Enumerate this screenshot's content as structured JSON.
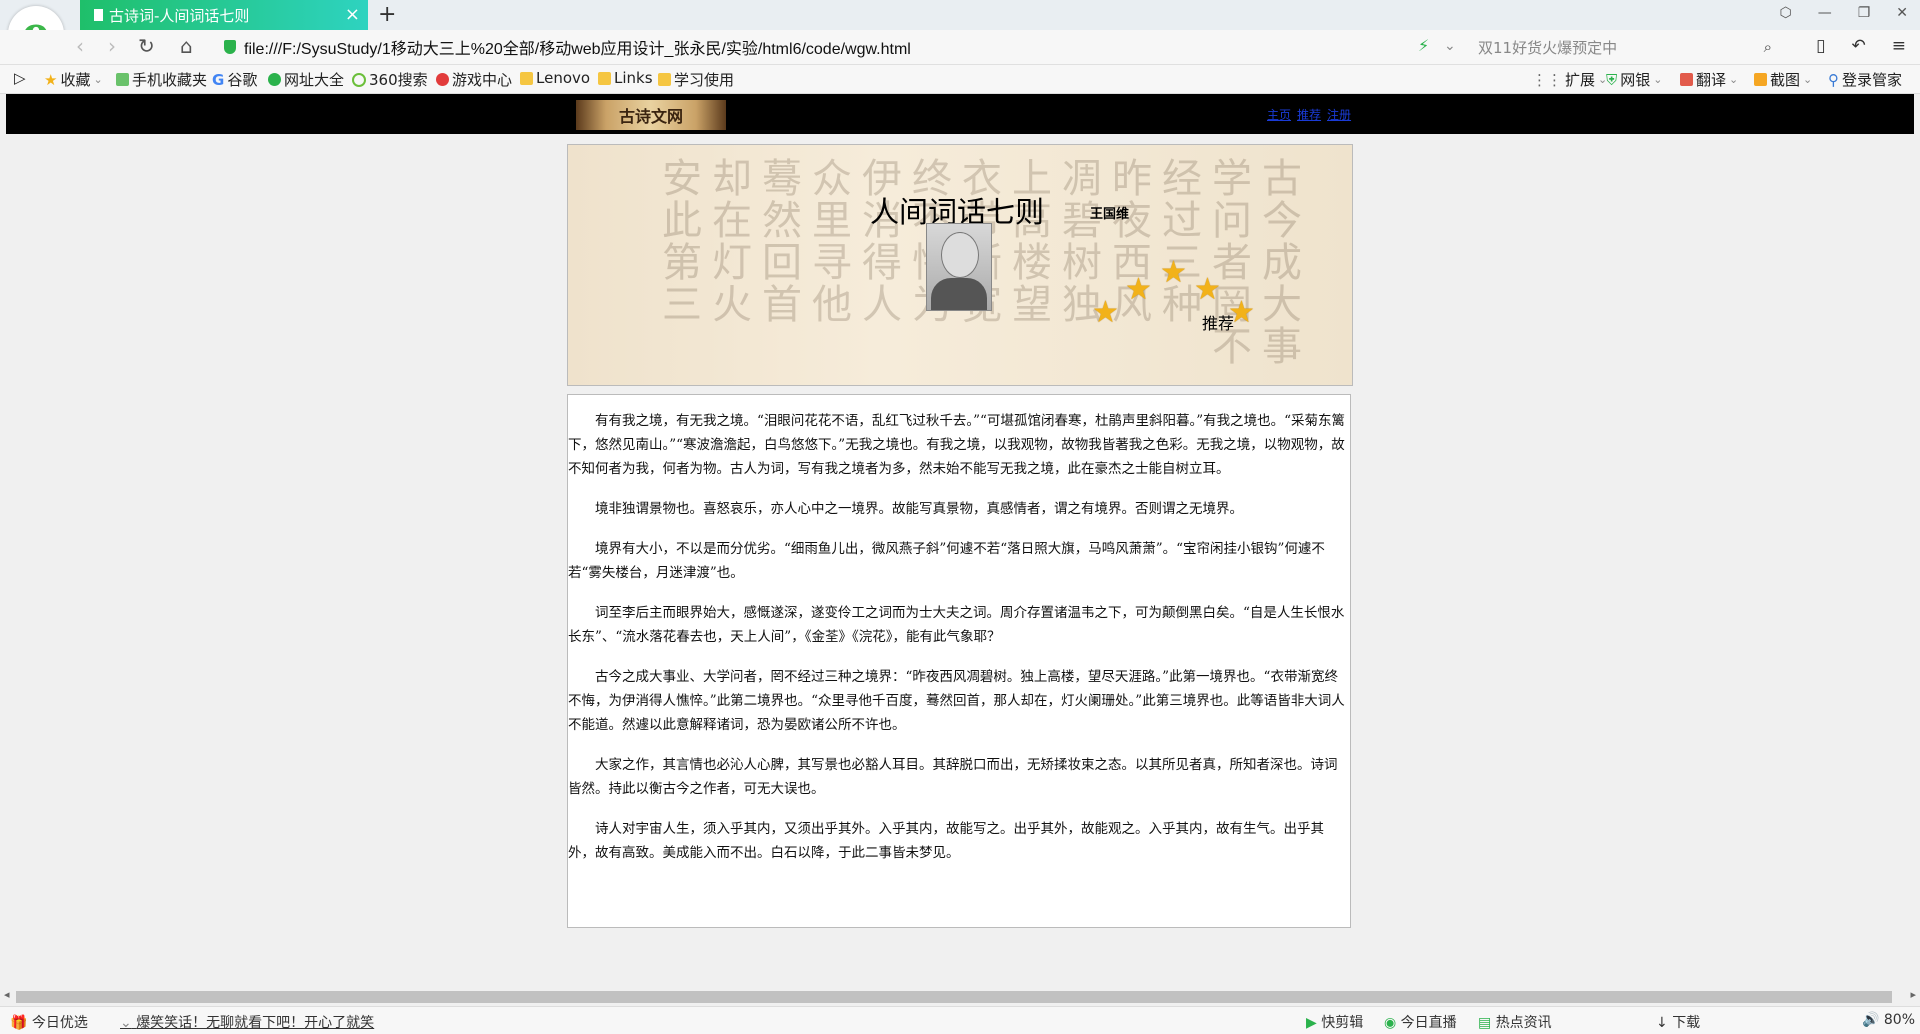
{
  "browser": {
    "tab_title": "古诗词-人间词话七则",
    "url": "file:///F:/SysuStudy/1移动大三上%20全部/移动web应用设计_张永民/实验/html6/code/wgw.html",
    "search_placeholder": "双11好货火爆预定中",
    "favorites": [
      "收藏",
      "手机收藏夹",
      "谷歌",
      "网址大全",
      "360搜索",
      "游戏中心",
      "Lenovo",
      "Links",
      "学习使用"
    ],
    "toolbar_right": [
      "扩展",
      "网银",
      "翻译",
      "截图",
      "登录管家"
    ]
  },
  "page": {
    "logo_text": "古诗文网",
    "nav_links": [
      "主页",
      "推荐",
      "注册"
    ],
    "title": "人间词话七则",
    "author": "王国维",
    "recommend_label": "推荐",
    "paragraphs": [
      "有有我之境，有无我之境。“泪眼问花花不语，乱红飞过秋千去。”“可堪孤馆闭春寒，杜鹃声里斜阳暮。”有我之境也。“采菊东篱下，悠然见南山。”“寒波澹澹起，白鸟悠悠下。”无我之境也。有我之境，以我观物，故物我皆著我之色彩。无我之境，以物观物，故不知何者为我，何者为物。古人为词，写有我之境者为多，然未始不能写无我之境，此在豪杰之士能自树立耳。",
      "境非独谓景物也。喜怒哀乐，亦人心中之一境界。故能写真景物，真感情者，谓之有境界。否则谓之无境界。",
      "境界有大小，不以是而分优劣。“细雨鱼儿出，微风燕子斜”何遽不若“落日照大旗，马鸣风萧萧”。“宝帘闲挂小银钩”何遽不若“雾失楼台，月迷津渡”也。",
      "词至李后主而眼界始大，感慨遂深，遂变伶工之词而为士大夫之词。周介存置诸温韦之下，可为颠倒黑白矣。“自是人生长恨水长东”、“流水落花春去也，天上人间”，《金荃》《浣花》，能有此气象耶？",
      "古今之成大事业、大学问者，罔不经过三种之境界：“昨夜西风凋碧树。独上高楼，望尽天涯路。”此第一境界也。“衣带渐宽终不悔，为伊消得人憔悴。”此第二境界也。“众里寻他千百度，蓦然回首，那人却在，灯火阑珊处。”此第三境界也。此等语皆非大词人不能道。然遽以此意解释诸词，恐为晏欧诸公所不许也。",
      "大家之作，其言情也必沁人心脾，其写景也必豁人耳目。其辞脱口而出，无矫揉妆束之态。以其所见者真，所知者深也。诗词皆然。持此以衡古今之作者，可无大误也。",
      "诗人对宇宙人生，须入乎其内，又须出乎其外。入乎其内，故能写之。出乎其外，故能观之。入乎其内，故有生气。出乎其外，故有高致。美成能入而不出。白石以降，于此二事皆未梦见。"
    ]
  },
  "statusbar": {
    "left_items": [
      "今日优选",
      "爆笑笑话！无聊就看下吧！开心了就笑"
    ],
    "right_items": [
      "快剪辑",
      "今日直播",
      "热点资讯",
      "下载",
      "80%"
    ]
  }
}
